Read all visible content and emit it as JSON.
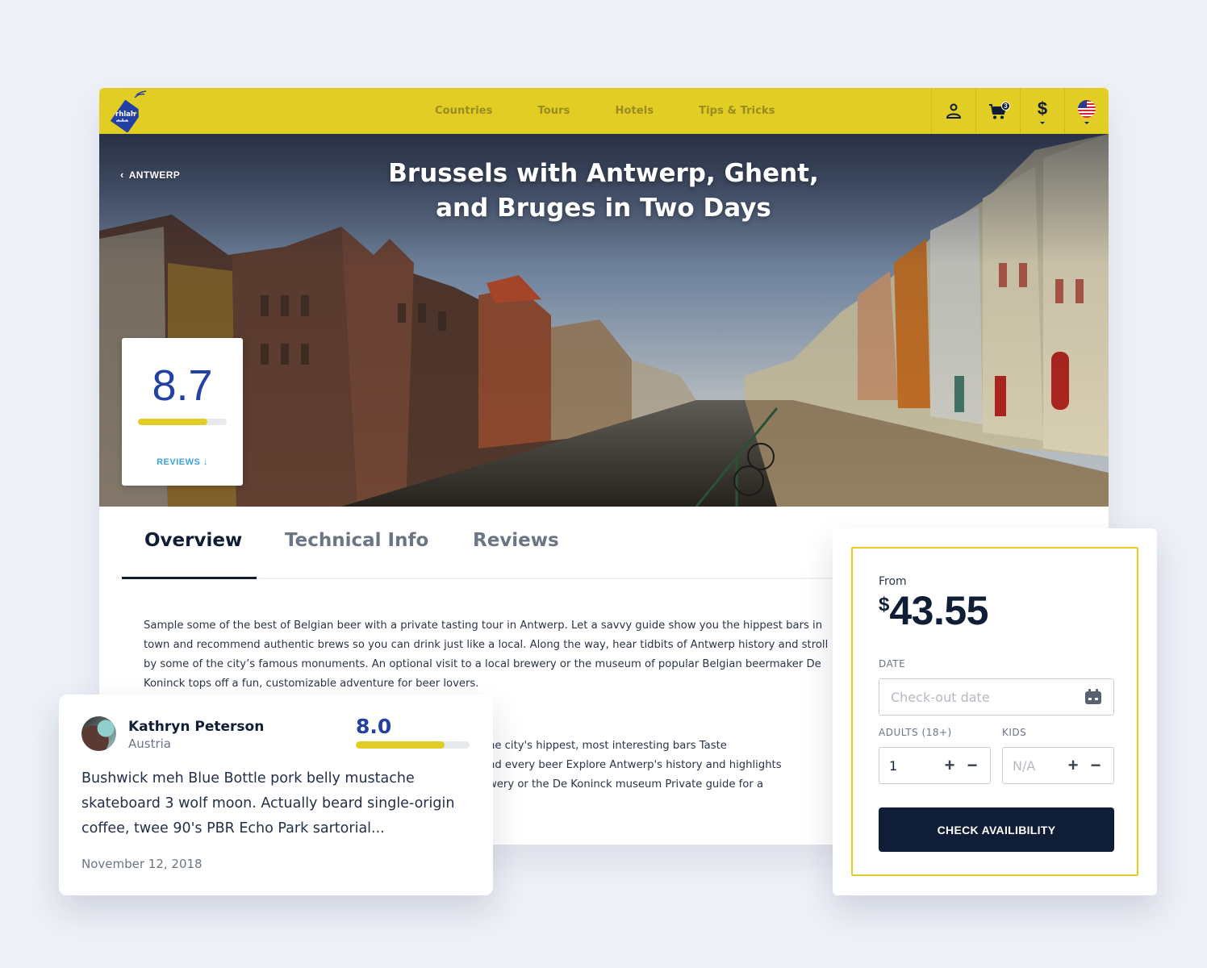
{
  "colors": {
    "background": "#edf0f7",
    "brand_yellow": "#e2cd24",
    "navy": "#0f1e36",
    "score_blue": "#2340a4",
    "link_blue": "#3ba3d6"
  },
  "nav": {
    "logo_text": "rhlah",
    "logo_icon": "price-tag-logo-icon",
    "links": [
      {
        "label": "Countries"
      },
      {
        "label": "Tours"
      },
      {
        "label": "Hotels"
      },
      {
        "label": "Tips & Tricks"
      }
    ],
    "icons": {
      "account": "user-icon",
      "cart": "cart-icon",
      "cart_count": "3",
      "currency": "$",
      "language": "us-flag-icon"
    }
  },
  "hero": {
    "back_label": "ANTWERP",
    "title_line1": "Brussels with Antwerp, Ghent,",
    "title_line2": "and Bruges in Two Days",
    "image": "canal-street-photo",
    "rating": {
      "score": "8.7",
      "score_fraction": 0.78,
      "reviews_link": "REVIEWS"
    }
  },
  "tabs": [
    {
      "label": "Overview",
      "active": true
    },
    {
      "label": "Technical Info",
      "active": false
    },
    {
      "label": "Reviews",
      "active": false
    }
  ],
  "overview": {
    "paragraph": "Sample some of the best of Belgian beer with a private tasting tour in Antwerp. Let a savvy guide show you the hippest bars in town and recommend authentic brews so you can drink just like a local. Along the way, hear tidbits of Antwerp history and stroll by some of the city’s famous monuments. An optional visit to a local brewery or the museum of popular Belgian beermaker De Koninck tops off a fun, customizable adventure for beer lovers.",
    "highlights_visible_lines": [
      "he city's hippest, most interesting bars Taste",
      "nd every beer Explore Antwerp's history and highlights",
      "wery or the De Koninck museum Private guide for a"
    ]
  },
  "review": {
    "name": "Kathryn Peterson",
    "country": "Austria",
    "score": "8.0",
    "score_fraction": 0.78,
    "body": "Bushwick meh Blue Bottle pork belly mustache skateboard 3 wolf moon. Actually beard single-origin coffee, twee 90's PBR Echo Park sartorial...",
    "date": "November 12, 2018"
  },
  "booking": {
    "from_label": "From",
    "currency_symbol": "$",
    "price": "43.55",
    "date_label": "DATE",
    "date_placeholder": "Check-out date",
    "date_value": "",
    "adults_label": "ADULTS (18+)",
    "adults_value": "1",
    "kids_label": "KIDS",
    "kids_value": "N/A",
    "plus": "+",
    "minus": "−",
    "cta_label": "CHECK AVAILIBILITY"
  }
}
